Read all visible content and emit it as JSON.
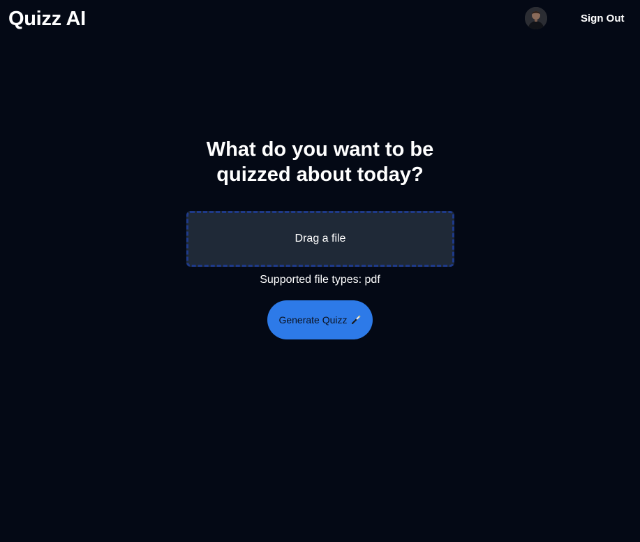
{
  "header": {
    "brand": "Quizz AI",
    "avatar_icon": "user-avatar",
    "sign_out_label": "Sign Out"
  },
  "main": {
    "headline": "What do you want to be quizzed about today?",
    "dropzone_label": "Drag a file",
    "supported_types": "Supported file types: pdf",
    "generate_label": "Generate Quizz",
    "generate_icon": "magic-wand-icon"
  },
  "colors": {
    "background": "#040915",
    "dropzone_bg": "#1f2937",
    "dropzone_border": "#1e3a8a",
    "accent": "#2d7ae8"
  }
}
